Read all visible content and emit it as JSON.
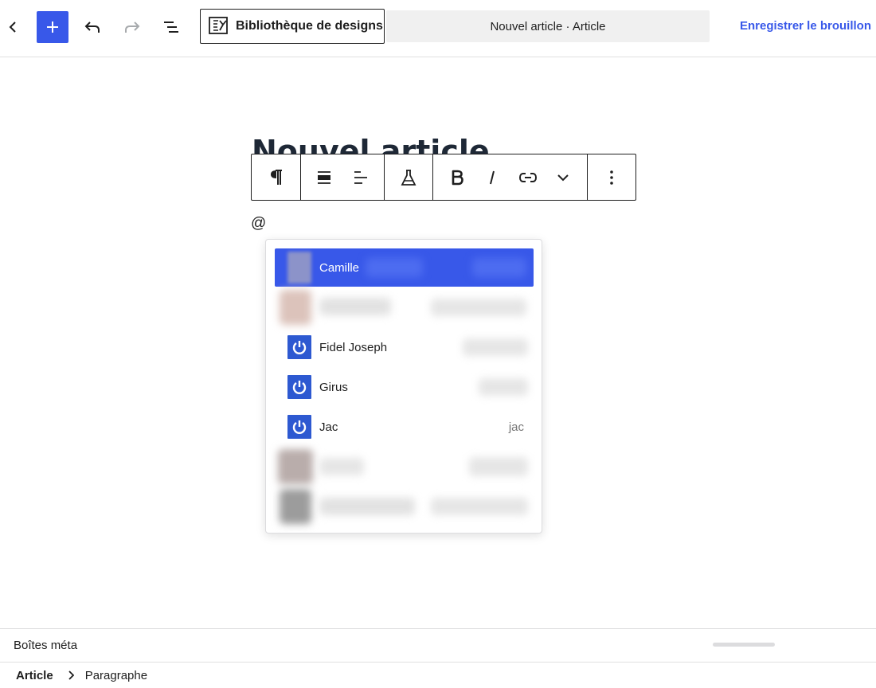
{
  "toolbar": {
    "pattern_library_label": "Bibliothèque de designs",
    "document_title": "Nouvel article · Article",
    "save_draft_label": "Enregistrer le brouillon"
  },
  "editor": {
    "post_title": "Nouvel article",
    "paragraph_text": "@"
  },
  "mentions": {
    "items": [
      {
        "name": "Camille",
        "slug": "",
        "selected": true
      },
      {
        "name": "Fidel Joseph",
        "slug": ""
      },
      {
        "name": "Girus",
        "slug": ""
      },
      {
        "name": "Jac",
        "slug": "jac"
      }
    ]
  },
  "footer": {
    "meta_boxes_label": "Boîtes méta",
    "breadcrumb_root": "Article",
    "breadcrumb_current": "Paragraphe"
  },
  "colors": {
    "accent": "#3858e9",
    "avatar_blue": "#2d59d1"
  }
}
